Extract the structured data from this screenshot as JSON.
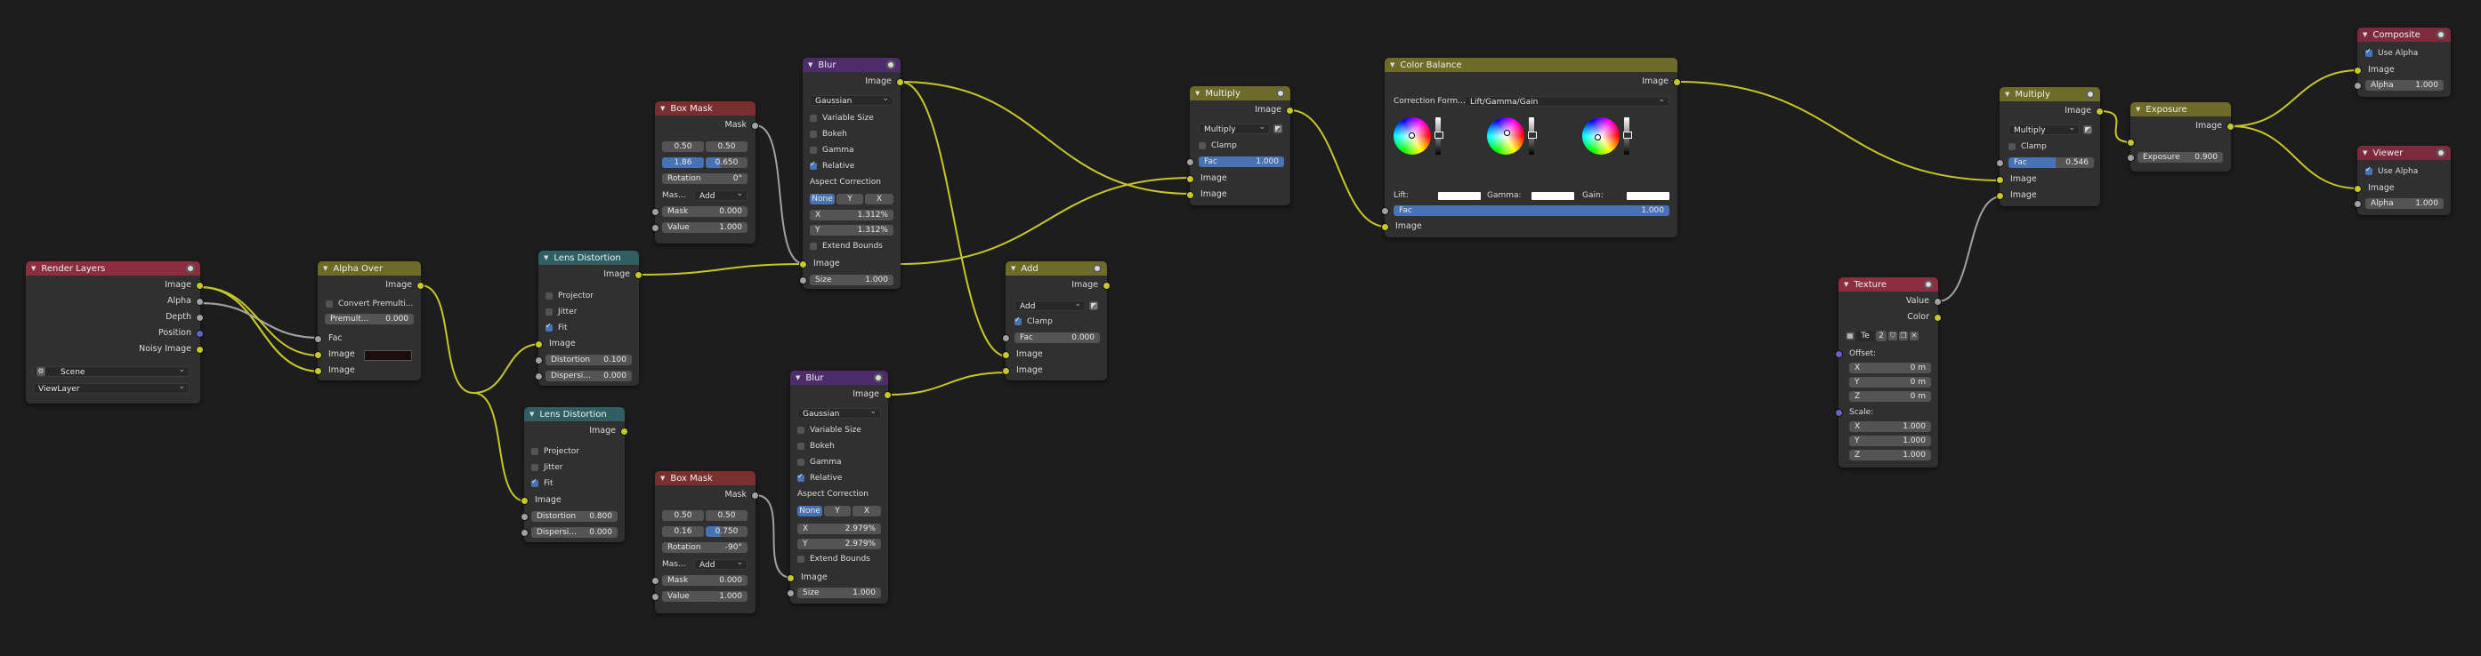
{
  "editor": {
    "name": "Compositor node editor"
  },
  "colors": {
    "background": "#1d1d1d",
    "socket_image": "#c7c729",
    "socket_value": "#a1a1a1",
    "socket_vector": "#6363c7",
    "active_field": "#4772b3"
  },
  "render_layers": {
    "title": "Render Layers",
    "outputs": [
      "Image",
      "Alpha",
      "Depth",
      "Position",
      "Noisy Image"
    ],
    "scene": "Scene",
    "layer": "ViewLayer"
  },
  "alpha_over": {
    "title": "Alpha Over",
    "convert": "Convert Premulti...",
    "premul_label": "Premult...",
    "premul_value": "0.000",
    "inputs": [
      "Fac",
      "Image",
      "Image"
    ],
    "output": "Image"
  },
  "lens1": {
    "title": "Lens Distortion",
    "output": "Image",
    "projector": "Projector",
    "jitter": "Jitter",
    "fit": "Fit",
    "input": "Image",
    "dist_label": "Distortion",
    "dist_value": "0.100",
    "disp_label": "Dispersi...",
    "disp_value": "0.000"
  },
  "lens2": {
    "title": "Lens Distortion",
    "output": "Image",
    "projector": "Projector",
    "jitter": "Jitter",
    "fit": "Fit",
    "input": "Image",
    "dist_label": "Distortion",
    "dist_value": "0.800",
    "disp_label": "Dispersi...",
    "disp_value": "0.000"
  },
  "boxmask1": {
    "title": "Box Mask",
    "output": "Mask",
    "x": "0.50",
    "y": "0.50",
    "w": "1.86",
    "h": "0.650",
    "rot_label": "Rotation",
    "rot_value": "0°",
    "mask_type_label": "Mas...",
    "mask_type": "Add",
    "mask_label": "Mask",
    "mask_value": "0.000",
    "value_label": "Value",
    "value_value": "1.000"
  },
  "boxmask2": {
    "title": "Box Mask",
    "output": "Mask",
    "x": "0.50",
    "y": "0.50",
    "w": "0.16",
    "h": "0.750",
    "rot_label": "Rotation",
    "rot_value": "-90°",
    "mask_type_label": "Mas...",
    "mask_type": "Add",
    "mask_label": "Mask",
    "mask_value": "0.000",
    "value_label": "Value",
    "value_value": "1.000"
  },
  "blur1": {
    "title": "Blur",
    "output": "Image",
    "filter": "Gaussian",
    "variable": "Variable Size",
    "bokeh": "Bokeh",
    "gamma": "Gamma",
    "relative": "Relative",
    "aspect": "Aspect Correction",
    "seg": [
      "None",
      "Y",
      "X"
    ],
    "x_label": "X",
    "x_value": "1.312%",
    "y_label": "Y",
    "y_value": "1.312%",
    "extend": "Extend Bounds",
    "input": "Image",
    "size_label": "Size",
    "size_value": "1.000"
  },
  "blur2": {
    "title": "Blur",
    "output": "Image",
    "filter": "Gaussian",
    "variable": "Variable Size",
    "bokeh": "Bokeh",
    "gamma": "Gamma",
    "relative": "Relative",
    "aspect": "Aspect Correction",
    "seg": [
      "None",
      "Y",
      "X"
    ],
    "x_label": "X",
    "x_value": "2.979%",
    "y_label": "Y",
    "y_value": "2.979%",
    "extend": "Extend Bounds",
    "input": "Image",
    "size_label": "Size",
    "size_value": "1.000"
  },
  "add": {
    "title": "Add",
    "output": "Image",
    "mode": "Add",
    "clamp": "Clamp",
    "fac_label": "Fac",
    "fac_value": "0.000",
    "inputs": [
      "Image",
      "Image"
    ]
  },
  "multiply1": {
    "title": "Multiply",
    "output": "Image",
    "mode": "Multiply",
    "clamp": "Clamp",
    "fac_label": "Fac",
    "fac_value": "1.000",
    "inputs": [
      "Image",
      "Image"
    ]
  },
  "colorbalance": {
    "title": "Color Balance",
    "output": "Image",
    "formula_label": "Correction Form...",
    "formula": "Lift/Gamma/Gain",
    "lift": "Lift:",
    "gamma": "Gamma:",
    "gain": "Gain:",
    "fac_label": "Fac",
    "fac_value": "1.000",
    "input": "Image"
  },
  "texture": {
    "title": "Texture",
    "value": "Value",
    "color": "Color",
    "tex": "Te",
    "users": "2",
    "offset": "Offset:",
    "scale": "Scale:",
    "ox": "0 m",
    "oy": "0 m",
    "oz": "0 m",
    "sx": "1.000",
    "sy": "1.000",
    "sz": "1.000",
    "xl": "X",
    "yl": "Y",
    "zl": "Z"
  },
  "multiply2": {
    "title": "Multiply",
    "output": "Image",
    "mode": "Multiply",
    "clamp": "Clamp",
    "fac_label": "Fac",
    "fac_value": "0.546",
    "inputs": [
      "Image",
      "Image"
    ]
  },
  "exposure": {
    "title": "Exposure",
    "output": "Image",
    "label": "Exposure",
    "value": "0.900"
  },
  "composite": {
    "title": "Composite",
    "use_alpha": "Use Alpha",
    "input": "Image",
    "alpha_label": "Alpha",
    "alpha_value": "1.000"
  },
  "viewer": {
    "title": "Viewer",
    "use_alpha": "Use Alpha",
    "input": "Image",
    "alpha_label": "Alpha",
    "alpha_value": "1.000"
  }
}
